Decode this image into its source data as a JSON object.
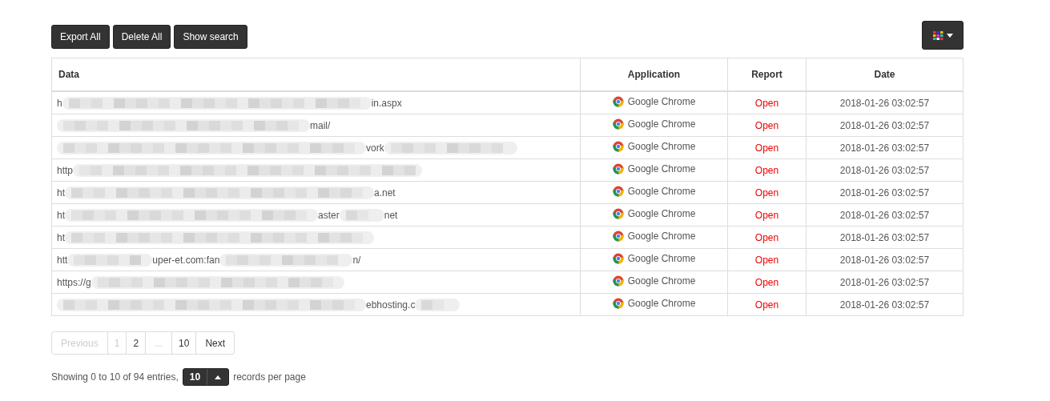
{
  "toolbar": {
    "buttons": [
      "Export All",
      "Delete All",
      "Show search"
    ],
    "column_menu": {
      "kind": "grid"
    }
  },
  "table": {
    "columns": [
      "Data",
      "Application",
      "Report",
      "Date"
    ],
    "rows": [
      {
        "data": [
          {
            "kind": "text",
            "text": "h"
          },
          {
            "kind": "blurxl"
          },
          {
            "kind": "text",
            "text": "in.aspx"
          }
        ],
        "application": "Google Chrome",
        "report": "Open",
        "date": "2018-01-26 03:02:57"
      },
      {
        "data": [
          {
            "kind": "blurl"
          },
          {
            "kind": "text",
            "text": "mail/"
          }
        ],
        "application": "Google Chrome",
        "report": "Open",
        "date": "2018-01-26 03:02:57"
      },
      {
        "data": [
          {
            "kind": "blurxl"
          },
          {
            "kind": "text",
            "text": "vork"
          },
          {
            "kind": "blurm"
          }
        ],
        "application": "Google Chrome",
        "report": "Open",
        "date": "2018-01-26 03:02:57"
      },
      {
        "data": [
          {
            "kind": "text",
            "text": "http"
          },
          {
            "kind": "blurxxl"
          }
        ],
        "application": "Google Chrome",
        "report": "Open",
        "date": "2018-01-26 03:02:57"
      },
      {
        "data": [
          {
            "kind": "text",
            "text": "ht"
          },
          {
            "kind": "blurxl"
          },
          {
            "kind": "text",
            "text": "a.net"
          }
        ],
        "application": "Google Chrome",
        "report": "Open",
        "date": "2018-01-26 03:02:57"
      },
      {
        "data": [
          {
            "kind": "text",
            "text": "ht"
          },
          {
            "kind": "blurl"
          },
          {
            "kind": "text",
            "text": "aster"
          },
          {
            "kind": "blurxs"
          },
          {
            "kind": "text",
            "text": "net"
          }
        ],
        "application": "Google Chrome",
        "report": "Open",
        "date": "2018-01-26 03:02:57"
      },
      {
        "data": [
          {
            "kind": "text",
            "text": "ht"
          },
          {
            "kind": "blurxl"
          }
        ],
        "application": "Google Chrome",
        "report": "Open",
        "date": "2018-01-26 03:02:57"
      },
      {
        "data": [
          {
            "kind": "text",
            "text": "htt"
          },
          {
            "kind": "blurs"
          },
          {
            "kind": "text",
            "text": "uper-et.com:fan"
          },
          {
            "kind": "blurm"
          },
          {
            "kind": "text",
            "text": "n/"
          }
        ],
        "application": "Google Chrome",
        "report": "Open",
        "date": "2018-01-26 03:02:57"
      },
      {
        "data": [
          {
            "kind": "text",
            "text": "https://g"
          },
          {
            "kind": "blurl"
          }
        ],
        "application": "Google Chrome",
        "report": "Open",
        "date": "2018-01-26 03:02:57"
      },
      {
        "data": [
          {
            "kind": "blurxl"
          },
          {
            "kind": "text",
            "text": "ebhosting.c"
          },
          {
            "kind": "blurxs"
          }
        ],
        "application": "Google Chrome",
        "report": "Open",
        "date": "2018-01-26 03:02:57"
      }
    ]
  },
  "pagination": [
    {
      "label": "Previous",
      "disabled": true
    },
    {
      "label": "1",
      "disabled": true
    },
    {
      "label": "2",
      "disabled": false
    },
    {
      "label": "...",
      "disabled": true
    },
    {
      "label": "10",
      "disabled": false
    },
    {
      "label": "Next",
      "disabled": false
    }
  ],
  "footer": {
    "summary": "Showing 0 to 10 of 94 entries,",
    "page_size": "10",
    "suffix": "records per page"
  }
}
